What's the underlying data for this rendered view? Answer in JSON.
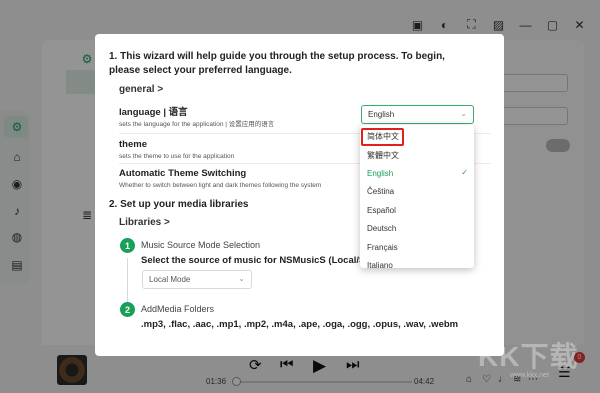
{
  "wizard": {
    "step1_title": "1. This wizard will help guide you through the setup process. To begin, please select your preferred language.",
    "general_section": "general >",
    "language_title": "language | 语言",
    "language_desc": "sets the language for the application | 设置应用的语言",
    "language_value": "English",
    "theme_title": "theme",
    "theme_desc": "sets the theme to use for the application",
    "auto_theme_title": "Automatic Theme Switching",
    "auto_theme_desc": "Whether to switch between light and dark themes following the system",
    "step2_title": "2. Set up your media libraries",
    "libraries_section": "Libraries >",
    "sub1_num": "1",
    "sub1_label": "Music Source Mode Selection",
    "sub1_desc": "Select the source of music for NSMusicS (Local/Se",
    "mode_value": "Local Mode",
    "sub2_num": "2",
    "sub2_label": "AddMedia Folders",
    "formats": ".mp3, .flac, .aac, .mp1, .mp2, .m4a, .ape, .oga, .ogg, .opus, .wav, .webm"
  },
  "language_dropdown": {
    "options": [
      "简体中文",
      "繁體中文",
      "English",
      "Čeština",
      "Español",
      "Deutsch",
      "Français",
      "Italiano"
    ],
    "selected": "English",
    "highlighted": "简体中文"
  },
  "player": {
    "current_time": "01:36",
    "total_time": "04:42",
    "progress": 0.0,
    "queue_badge": "0"
  },
  "watermark": {
    "text": "KK下载",
    "url": "www.kkx.net"
  },
  "colors": {
    "accent": "#18a058",
    "highlight_border": "#e0201b",
    "badge": "#e53935"
  }
}
